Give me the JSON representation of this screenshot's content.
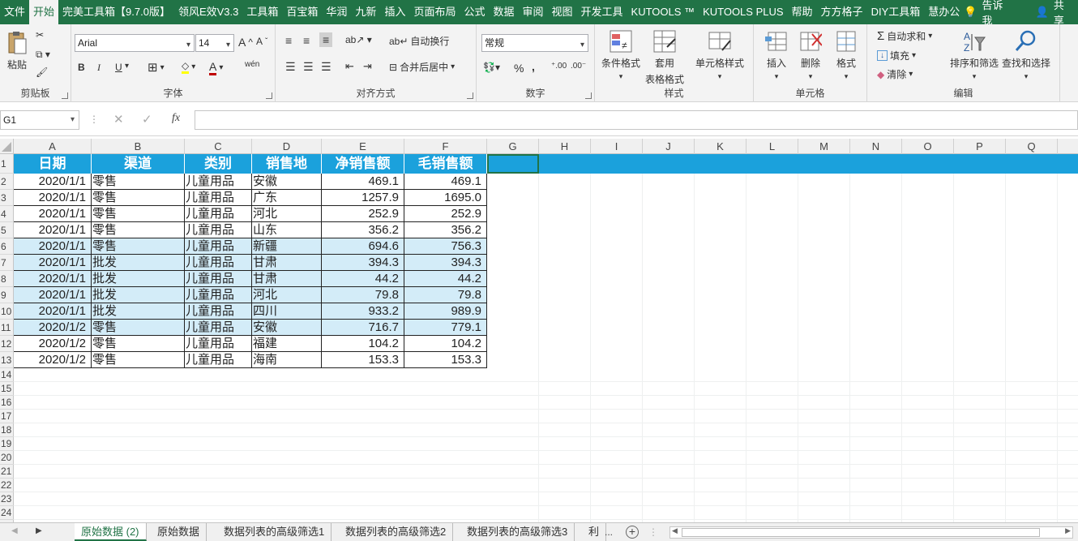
{
  "menu": {
    "items": [
      "文件",
      "开始",
      "完美工具箱【9.7.0版】",
      "领风E效V3.3",
      "工具箱",
      "百宝箱",
      "华润",
      "九新",
      "插入",
      "页面布局",
      "公式",
      "数据",
      "审阅",
      "视图",
      "开发工具",
      "KUTOOLS ™",
      "KUTOOLS PLUS",
      "帮助",
      "方方格子",
      "DIY工具箱",
      "慧办公"
    ],
    "active_index": 1,
    "tell_me": "告诉我",
    "share": "共享"
  },
  "ribbon": {
    "clipboard": {
      "paste": "粘贴",
      "label": "剪贴板"
    },
    "font": {
      "name": "Arial",
      "size": "14",
      "bold": "B",
      "italic": "I",
      "underline": "U",
      "label": "字体",
      "wen": "wén"
    },
    "align": {
      "wrap": "自动换行",
      "merge": "合并后居中",
      "label": "对齐方式"
    },
    "number": {
      "format": "常规",
      "percent": "%",
      "comma": ",",
      "label": "数字"
    },
    "styles": {
      "cond": "条件格式",
      "table1": "套用",
      "table2": "表格格式",
      "cell_style": "单元格样式",
      "label": "样式"
    },
    "cells": {
      "insert": "插入",
      "delete": "删除",
      "format": "格式",
      "label": "单元格"
    },
    "edit": {
      "autosum": "自动求和",
      "fill": "填充",
      "clear": "清除",
      "sort": "排序和筛选",
      "find": "查找和选择",
      "label": "编辑"
    }
  },
  "formula_bar": {
    "name_box": "G1",
    "fx": "fx",
    "content": ""
  },
  "columns": [
    "A",
    "B",
    "C",
    "D",
    "E",
    "F",
    "G",
    "H",
    "I",
    "J",
    "K",
    "L",
    "M",
    "N",
    "O",
    "P",
    "Q"
  ],
  "rows": [
    "1",
    "2",
    "3",
    "4",
    "5",
    "6",
    "7",
    "8",
    "9",
    "10",
    "11",
    "12",
    "13",
    "14",
    "15",
    "16",
    "17",
    "18",
    "19",
    "20",
    "21",
    "22",
    "23",
    "24"
  ],
  "table": {
    "headers": [
      "日期",
      "渠道",
      "类别",
      "销售地",
      "净销售额",
      "毛销售额"
    ],
    "header_color": "#1ba1dc",
    "highlight_color": "#d3ecf8",
    "highlight_rows": [
      6,
      7,
      8,
      9,
      10
    ],
    "rows": [
      [
        "2020/1/1",
        "零售",
        "儿童用品",
        "安徽",
        "469.1",
        "469.1"
      ],
      [
        "2020/1/1",
        "零售",
        "儿童用品",
        "广东",
        "1257.9",
        "1695.0"
      ],
      [
        "2020/1/1",
        "零售",
        "儿童用品",
        "河北",
        "252.9",
        "252.9"
      ],
      [
        "2020/1/1",
        "零售",
        "儿童用品",
        "山东",
        "356.2",
        "356.2"
      ],
      [
        "2020/1/1",
        "零售",
        "儿童用品",
        "新疆",
        "694.6",
        "756.3"
      ],
      [
        "2020/1/1",
        "批发",
        "儿童用品",
        "甘肃",
        "394.3",
        "394.3"
      ],
      [
        "2020/1/1",
        "批发",
        "儿童用品",
        "甘肃",
        "44.2",
        "44.2"
      ],
      [
        "2020/1/1",
        "批发",
        "儿童用品",
        "河北",
        "79.8",
        "79.8"
      ],
      [
        "2020/1/1",
        "批发",
        "儿童用品",
        "四川",
        "933.2",
        "989.9"
      ],
      [
        "2020/1/2",
        "零售",
        "儿童用品",
        "安徽",
        "716.7",
        "779.1"
      ],
      [
        "2020/1/2",
        "零售",
        "儿童用品",
        "福建",
        "104.2",
        "104.2"
      ],
      [
        "2020/1/2",
        "零售",
        "儿童用品",
        "海南",
        "153.3",
        "153.3"
      ]
    ]
  },
  "sheets": {
    "tabs": [
      "原始数据 (2)",
      "原始数据",
      "数据列表的高级筛选1",
      "数据列表的高级筛选2",
      "数据列表的高级筛选3",
      "利"
    ],
    "active_index": 0,
    "more": "...",
    "add": "+"
  }
}
